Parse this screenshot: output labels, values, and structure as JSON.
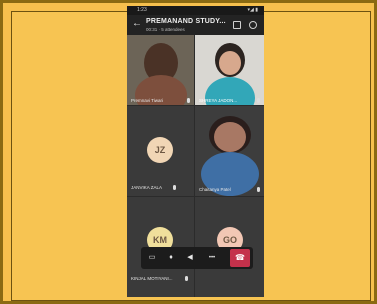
{
  "statusbar": {
    "time": "1:23",
    "icons": "▾◢ ▮"
  },
  "header": {
    "back_icon": "←",
    "title": "PREMANAND STUDY...",
    "subtitle": "00:31 · 5 attendees"
  },
  "participants": [
    {
      "name": "Premnavi Tiwari",
      "type": "video"
    },
    {
      "name": "SHREYA JADON...",
      "type": "video"
    },
    {
      "name": "JANVIKA ZALA",
      "initials": "JZ",
      "type": "avatar"
    },
    {
      "name": "Chaitanya Patel",
      "type": "video"
    },
    {
      "name": "KINJAL MOTIYANI...",
      "initials": "KM",
      "type": "avatar"
    },
    {
      "name": "",
      "initials": "GO",
      "type": "avatar"
    }
  ],
  "callbar": {
    "camera_icon": "▭",
    "mic_icon": "♦",
    "speaker_icon": "◀",
    "more_icon": "•••",
    "hangup_icon": "☎"
  }
}
